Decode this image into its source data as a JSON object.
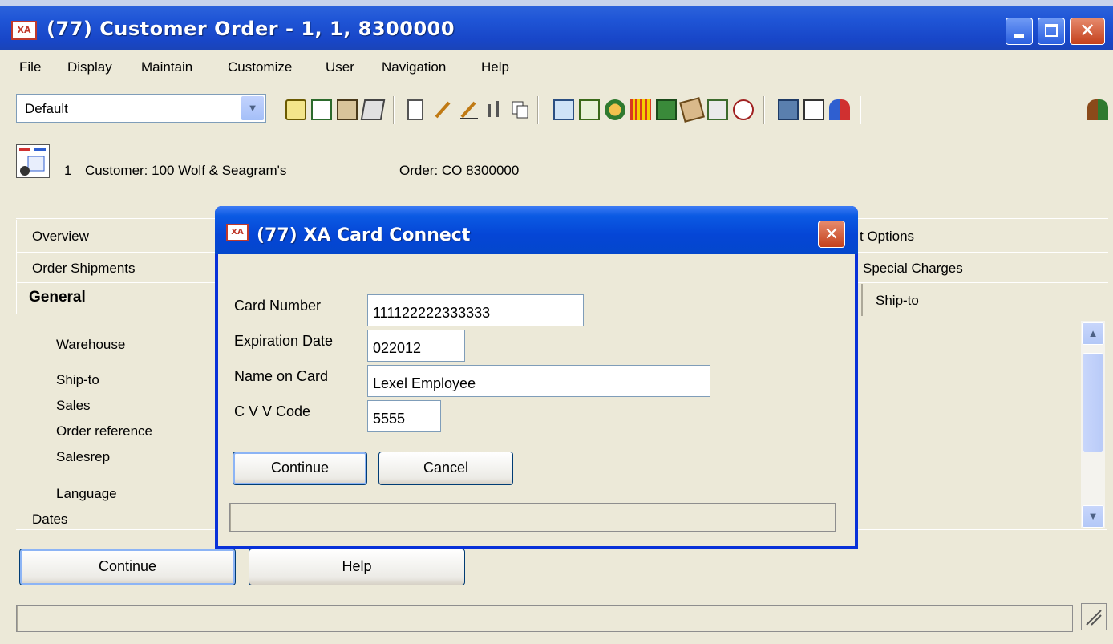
{
  "window": {
    "title": "(77) Customer Order - 1, 1, 8300000",
    "app_badge": "XA"
  },
  "menu": [
    "File",
    "Display",
    "Maintain",
    "Customize",
    "User",
    "Navigation",
    "Help"
  ],
  "toolbar": {
    "view_value": "Default"
  },
  "header": {
    "line_no": "1",
    "customer": "Customer: 100  Wolf & Seagram's",
    "order": "Order: CO 8300000"
  },
  "tabs": {
    "overview": "Overview",
    "order_shipments": "Order Shipments",
    "general": "General",
    "options_partial": "t Options",
    "special_charges": "Special Charges",
    "ship_to": "Ship-to"
  },
  "general_fields": [
    "Warehouse",
    "Ship-to",
    "Sales",
    "Order reference",
    "Salesrep",
    "Language",
    "Dates"
  ],
  "buttons": {
    "continue": "Continue",
    "help": "Help"
  },
  "dialog": {
    "title": "(77) XA Card Connect",
    "badge": "XA",
    "card_number_label": "Card Number",
    "card_number": "111122222333333",
    "expiration_label": "Expiration Date",
    "expiration": "022012",
    "name_label": "Name on Card",
    "name": "Lexel Employee",
    "cvv_label": "C V V Code",
    "cvv": "5555",
    "continue": "Continue",
    "cancel": "Cancel"
  },
  "colors": {
    "window_face": "#ece9d8",
    "titlebar_blue": "#1f55d6",
    "close_red": "#c4401c"
  }
}
